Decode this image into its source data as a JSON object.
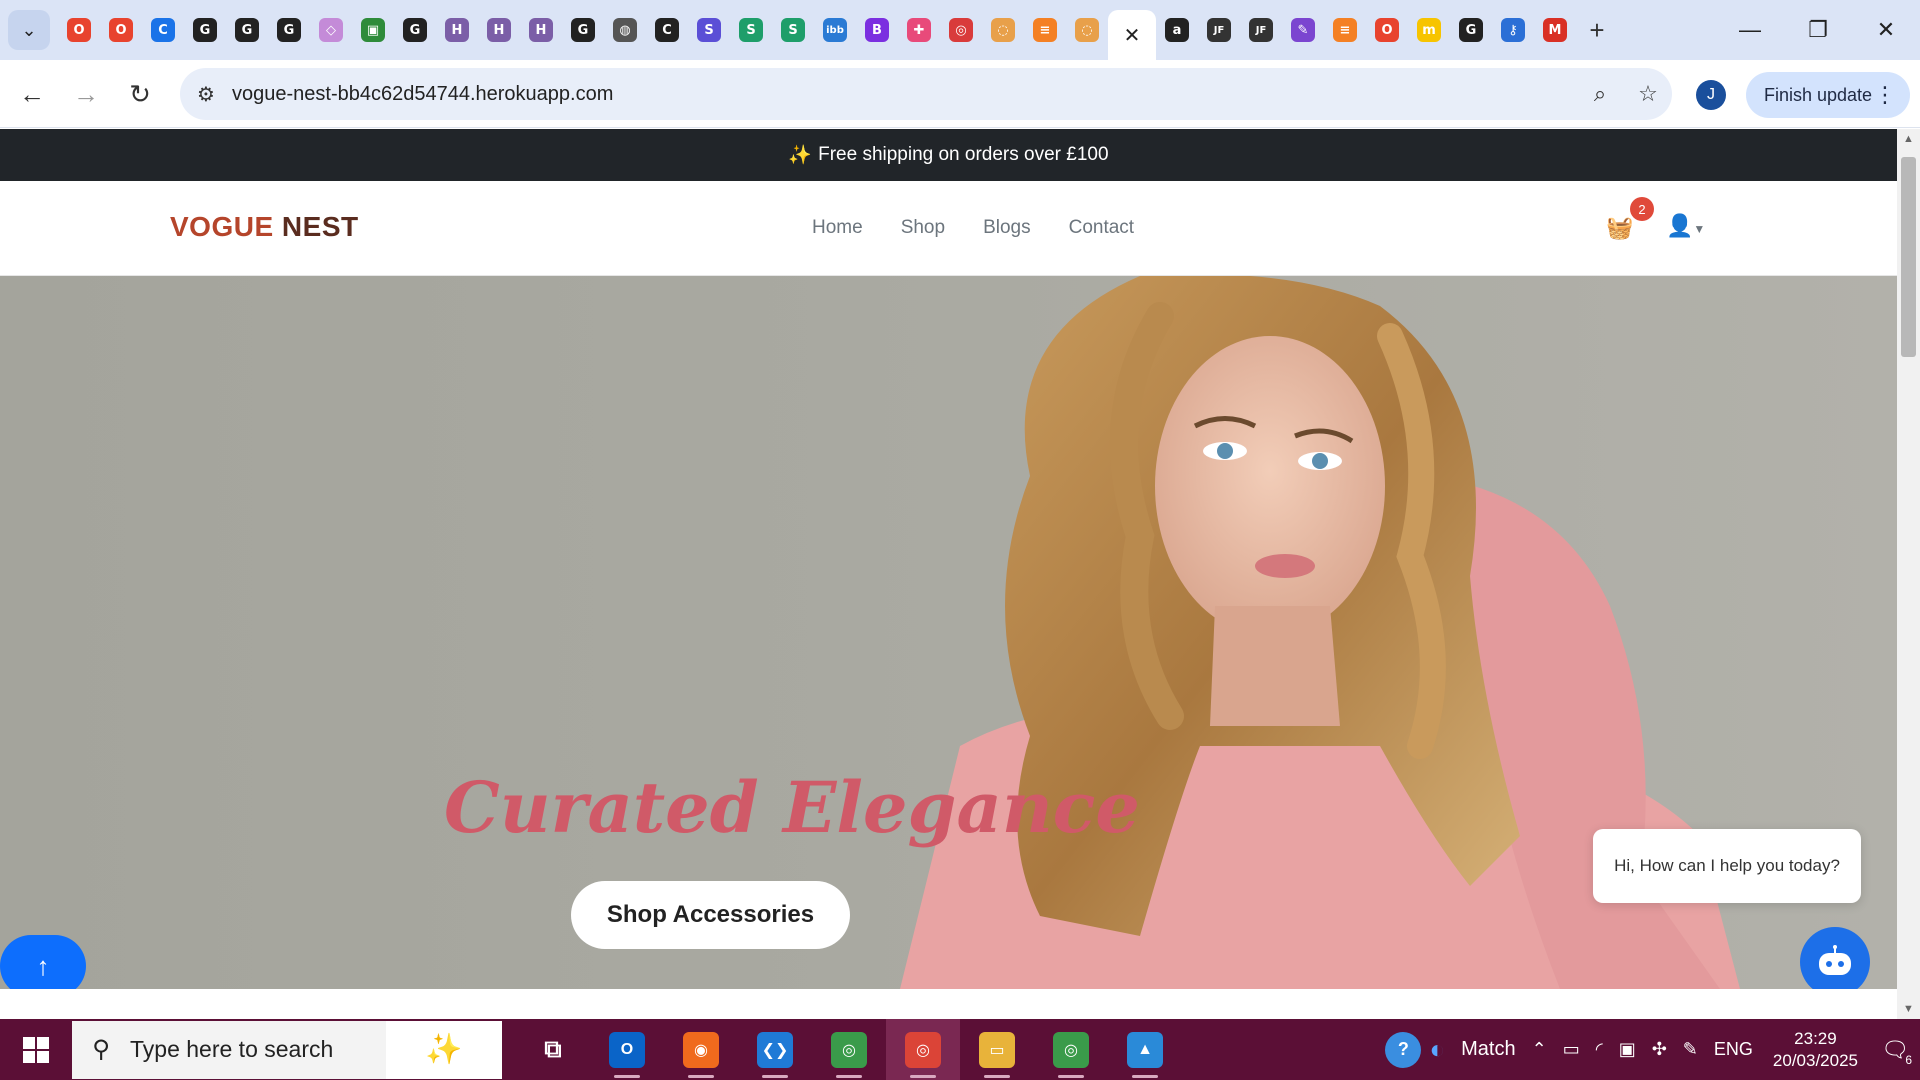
{
  "browser": {
    "tabs": [
      {
        "icon": "opera-red-icon",
        "color": "#e8432e",
        "glyph": "O"
      },
      {
        "icon": "opera-red-icon",
        "color": "#e8432e",
        "glyph": "O"
      },
      {
        "icon": "copilot-c-icon",
        "color": "#1a73e8",
        "glyph": "C"
      },
      {
        "icon": "github-icon",
        "color": "#222222",
        "glyph": "G"
      },
      {
        "icon": "github-icon",
        "color": "#222222",
        "glyph": "G"
      },
      {
        "icon": "github-icon",
        "color": "#222222",
        "glyph": "G"
      },
      {
        "icon": "cube-icon",
        "color": "#c48bd8",
        "glyph": "◇"
      },
      {
        "icon": "sheet-icon",
        "color": "#2e8b3a",
        "glyph": "▣"
      },
      {
        "icon": "github-icon",
        "color": "#222222",
        "glyph": "G"
      },
      {
        "icon": "heroku-icon",
        "color": "#7b5ea7",
        "glyph": "H"
      },
      {
        "icon": "heroku-icon",
        "color": "#7b5ea7",
        "glyph": "H"
      },
      {
        "icon": "heroku-icon",
        "color": "#7b5ea7",
        "glyph": "H"
      },
      {
        "icon": "github-icon",
        "color": "#222222",
        "glyph": "G"
      },
      {
        "icon": "globe-icon",
        "color": "#555555",
        "glyph": "◍"
      },
      {
        "icon": "c-logo-icon",
        "color": "#222222",
        "glyph": "C"
      },
      {
        "icon": "s-purple-icon",
        "color": "#5b4fd6",
        "glyph": "S"
      },
      {
        "icon": "s-green-icon",
        "color": "#1e9e6a",
        "glyph": "S"
      },
      {
        "icon": "s-green-icon",
        "color": "#1e9e6a",
        "glyph": "S"
      },
      {
        "icon": "ibb-icon",
        "color": "#2a7ad4",
        "glyph": "ibb"
      },
      {
        "icon": "bootstrap-icon",
        "color": "#7b2fe0",
        "glyph": "B"
      },
      {
        "icon": "puzzle-icon",
        "color": "#e84a7a",
        "glyph": "✚"
      },
      {
        "icon": "target-icon",
        "color": "#d93b3b",
        "glyph": "◎"
      },
      {
        "icon": "spinner-icon",
        "color": "#e8a04a",
        "glyph": "◌"
      },
      {
        "icon": "stackoverflow-icon",
        "color": "#f48024",
        "glyph": "≡"
      },
      {
        "icon": "spinner-icon",
        "color": "#e8a04a",
        "glyph": "◌"
      }
    ],
    "tabs_after": [
      {
        "icon": "amazon-icon",
        "color": "#222222",
        "glyph": "a"
      },
      {
        "icon": "jf-icon",
        "color": "#333333",
        "glyph": "JF"
      },
      {
        "icon": "jf-icon",
        "color": "#333333",
        "glyph": "JF"
      },
      {
        "icon": "marker-icon",
        "color": "#7b45d0",
        "glyph": "✎"
      },
      {
        "icon": "stackoverflow-icon",
        "color": "#f48024",
        "glyph": "≡"
      },
      {
        "icon": "opera-red-icon",
        "color": "#e8432e",
        "glyph": "O"
      },
      {
        "icon": "miro-icon",
        "color": "#f7c400",
        "glyph": "m"
      },
      {
        "icon": "github-icon",
        "color": "#222222",
        "glyph": "G"
      },
      {
        "icon": "key-icon",
        "color": "#2b6fd6",
        "glyph": "⚷"
      },
      {
        "icon": "gmail-icon",
        "color": "#d93025",
        "glyph": "M"
      }
    ],
    "active_tab_close": "✕",
    "new_tab": "+",
    "url": "vogue-nest-bb4c62d54744.herokuapp.com",
    "profile_initial": "J",
    "finish_update_label": "Finish update",
    "back": "←",
    "forward": "→",
    "reload": "↻"
  },
  "site": {
    "announcement_icon": "✨",
    "announcement": "Free shipping on orders over £100",
    "logo_part1": "VOGUE",
    "logo_part2": "NEST",
    "nav": [
      "Home",
      "Shop",
      "Blogs",
      "Contact"
    ],
    "cart_count": "2",
    "hero_title": "Curated Elegance",
    "hero_button": "Shop Accessories",
    "chat_message": "Hi, How can I help you today?",
    "back_to_top": "↑"
  },
  "taskbar": {
    "search_placeholder": "Type here to search",
    "apps": [
      {
        "name": "task-view-icon",
        "glyph": "⧉",
        "color": "transparent"
      },
      {
        "name": "outlook-icon",
        "glyph": "O",
        "color": "#0a64c8"
      },
      {
        "name": "firefox-icon",
        "glyph": "◉",
        "color": "#f06a1d"
      },
      {
        "name": "vscode-icon",
        "glyph": "❮❯",
        "color": "#1f7ad6"
      },
      {
        "name": "chrome-icon",
        "glyph": "◎",
        "color": "#3a9b4a"
      },
      {
        "name": "chrome-j-icon",
        "glyph": "◎",
        "color": "#db4437"
      },
      {
        "name": "file-explorer-icon",
        "glyph": "▭",
        "color": "#e8b33a"
      },
      {
        "name": "chrome-j2-icon",
        "glyph": "◎",
        "color": "#3a9b4a"
      },
      {
        "name": "photos-icon",
        "glyph": "▲",
        "color": "#2a8ad8"
      }
    ],
    "help_icon": "?",
    "match_label": "Match",
    "lang": "ENG",
    "time": "23:29",
    "date": "20/03/2025",
    "notif_count": "6"
  }
}
